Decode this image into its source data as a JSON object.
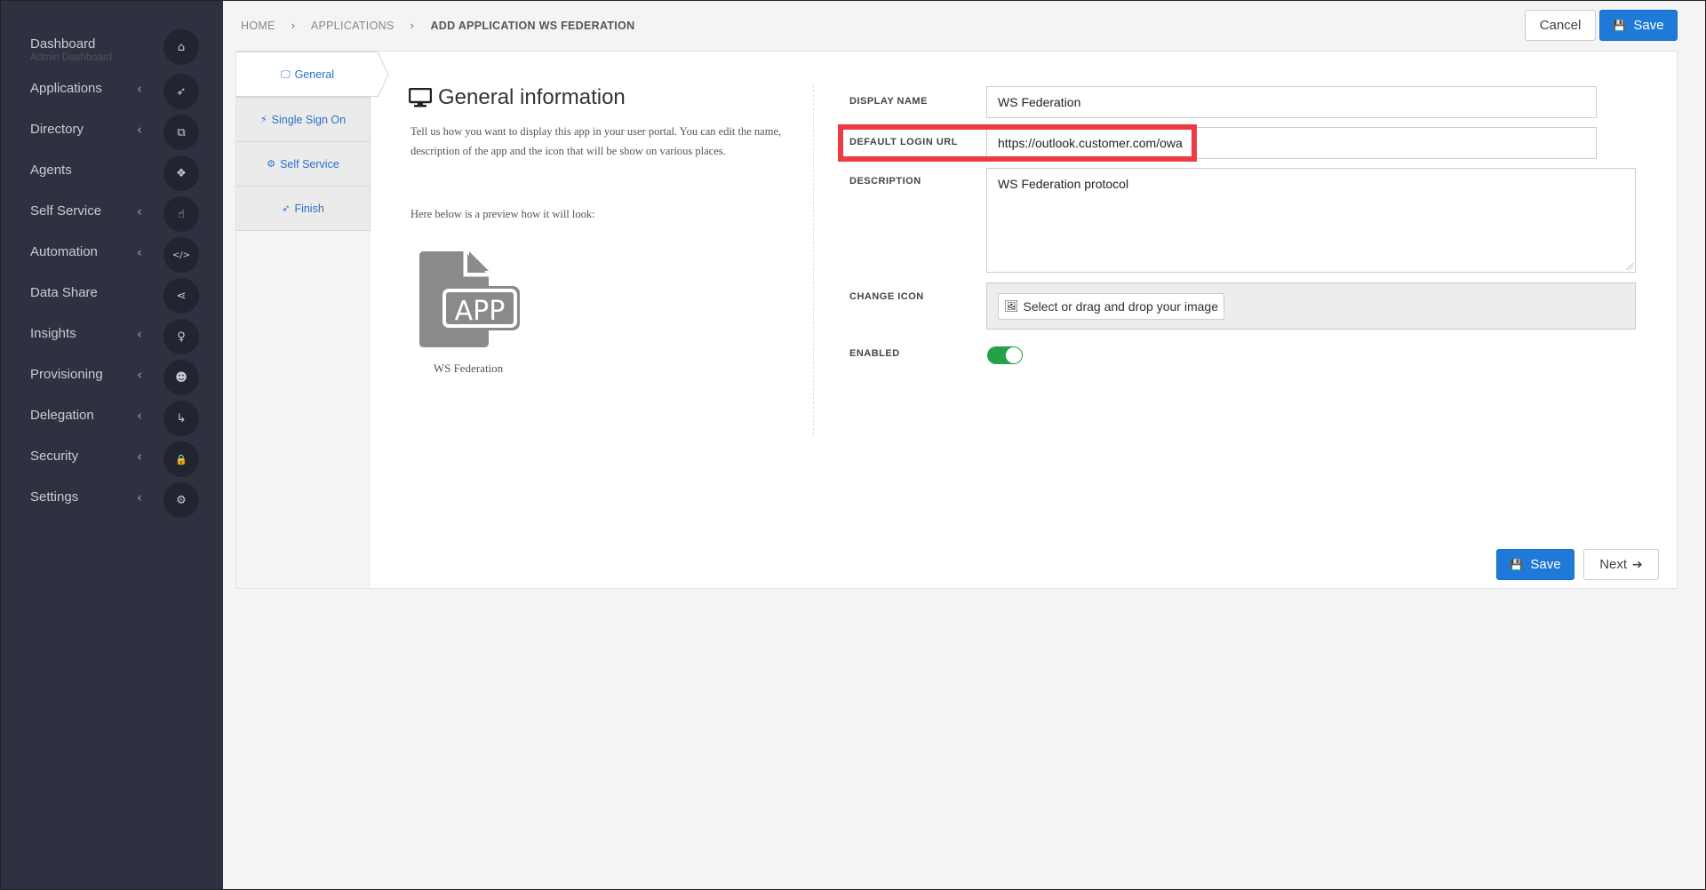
{
  "sidebar": {
    "items": [
      {
        "label": "Dashboard",
        "sub": "Admin Dashboard",
        "chevron": "",
        "icon": "home-icon",
        "glyph": "⌂"
      },
      {
        "label": "Applications",
        "chevron": "‹",
        "icon": "rocket-icon",
        "glyph": "➶"
      },
      {
        "label": "Directory",
        "chevron": "‹",
        "icon": "sitemap-icon",
        "glyph": "⧉"
      },
      {
        "label": "Agents",
        "chevron": "",
        "icon": "cubes-icon",
        "glyph": "❖"
      },
      {
        "label": "Self Service",
        "chevron": "‹",
        "icon": "hand-pointer-icon",
        "glyph": "☝"
      },
      {
        "label": "Automation",
        "chevron": "‹",
        "icon": "code-icon",
        "glyph": "</>"
      },
      {
        "label": "Data Share",
        "chevron": "",
        "icon": "share-icon",
        "glyph": "⋖"
      },
      {
        "label": "Insights",
        "chevron": "‹",
        "icon": "lightbulb-icon",
        "glyph": "♀"
      },
      {
        "label": "Provisioning",
        "chevron": "‹",
        "icon": "users-icon",
        "glyph": "☻"
      },
      {
        "label": "Delegation",
        "chevron": "‹",
        "icon": "level-down-icon",
        "glyph": "↳"
      },
      {
        "label": "Security",
        "chevron": "‹",
        "icon": "lock-icon",
        "glyph": "🔒"
      },
      {
        "label": "Settings",
        "chevron": "‹",
        "icon": "gear-icon",
        "glyph": "⚙"
      }
    ]
  },
  "breadcrumb": {
    "home": "HOME",
    "applications": "APPLICATIONS",
    "current": "ADD APPLICATION WS FEDERATION",
    "separator": "›"
  },
  "header": {
    "cancel_label": "Cancel",
    "save_label": "Save"
  },
  "tabs": [
    {
      "label": "General",
      "icon": "desktop-icon",
      "glyph": "🖵"
    },
    {
      "label": "Single Sign On",
      "icon": "plug-icon",
      "glyph": "⚡"
    },
    {
      "label": "Self Service",
      "icon": "cogs-icon",
      "glyph": "⚙"
    },
    {
      "label": "Finish",
      "icon": "rocket-icon",
      "glyph": "➶"
    }
  ],
  "general": {
    "title": "General information",
    "description": "Tell us how you want to display this app in your user portal. You can edit the name, description of the app and the icon that will be show on various places.",
    "preview_text": "Here below is a preview how it will look:",
    "app_icon_text": "APP",
    "app_caption": "WS Federation"
  },
  "form": {
    "display_name_label": "DISPLAY NAME",
    "display_name_value": "WS Federation",
    "login_url_label": "DEFAULT LOGIN URL",
    "login_url_value": "https://outlook.customer.com/owa",
    "description_label": "DESCRIPTION",
    "description_value": "WS Federation protocol",
    "change_icon_label": "CHANGE ICON",
    "change_icon_button": "Select or drag and drop your image",
    "enabled_label": "ENABLED",
    "enabled": true
  },
  "footer": {
    "save_label": "Save",
    "next_label": "Next"
  },
  "colors": {
    "sidebar_bg": "#2f3140",
    "primary": "#1e7ad6",
    "toggle_on": "#25a249",
    "highlight": "#ee3a42",
    "tab_link": "#2b70c9"
  }
}
